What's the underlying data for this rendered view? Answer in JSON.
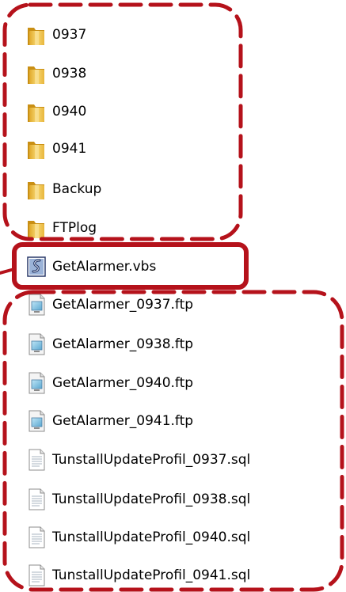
{
  "items": [
    {
      "label": "0937",
      "icon": "folder-icon",
      "type": "folder"
    },
    {
      "label": "0938",
      "icon": "folder-icon",
      "type": "folder"
    },
    {
      "label": "0940",
      "icon": "folder-icon",
      "type": "folder"
    },
    {
      "label": "0941",
      "icon": "folder-icon",
      "type": "folder"
    },
    {
      "label": "Backup",
      "icon": "folder-icon",
      "type": "folder"
    },
    {
      "label": "FTPlog",
      "icon": "folder-icon",
      "type": "folder"
    },
    {
      "label": "GetAlarmer.vbs",
      "icon": "vbs-script-icon",
      "type": "vbs"
    },
    {
      "label": "GetAlarmer_0937.ftp",
      "icon": "ftp-file-icon",
      "type": "ftp"
    },
    {
      "label": "GetAlarmer_0938.ftp",
      "icon": "ftp-file-icon",
      "type": "ftp"
    },
    {
      "label": "GetAlarmer_0940.ftp",
      "icon": "ftp-file-icon",
      "type": "ftp"
    },
    {
      "label": "GetAlarmer_0941.ftp",
      "icon": "ftp-file-icon",
      "type": "ftp"
    },
    {
      "label": "TunstallUpdateProfil_0937.sql",
      "icon": "sql-file-icon",
      "type": "sql"
    },
    {
      "label": "TunstallUpdateProfil_0938.sql",
      "icon": "sql-file-icon",
      "type": "sql"
    },
    {
      "label": "TunstallUpdateProfil_0940.sql",
      "icon": "sql-file-icon",
      "type": "sql"
    },
    {
      "label": "TunstallUpdateProfil_0941.sql",
      "icon": "sql-file-icon",
      "type": "sql"
    }
  ],
  "colors": {
    "annotation_red": "#b5121b",
    "folder_body": "#f2c94c",
    "folder_dark": "#d9a520"
  }
}
